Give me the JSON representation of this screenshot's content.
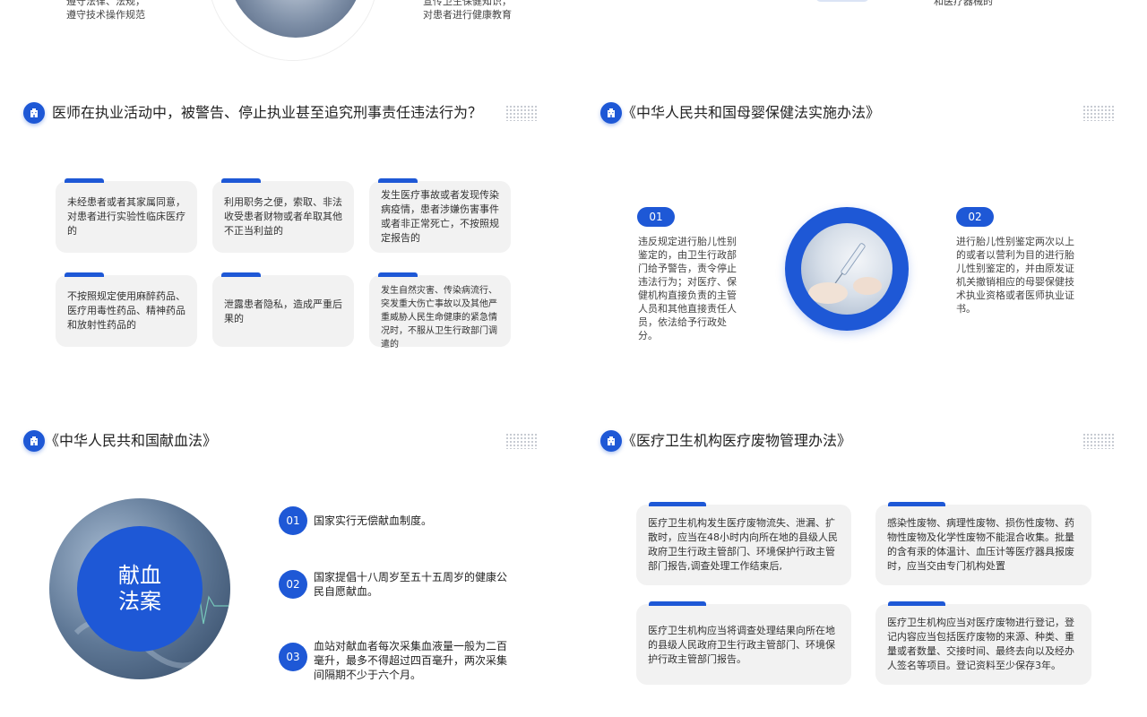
{
  "top_strip": {
    "left_text": "遵守法律、法规，\n遵守技术操作规范",
    "middle_text": "宣传卫生保健知识，\n对患者进行健康教育",
    "right_text": "和医疗器械的"
  },
  "sections": {
    "s1": {
      "title": "医师在执业活动中，被警告、停止执业甚至追究刑事责任违法行为？"
    },
    "s2": {
      "title": "《中华人民共和国母婴保健法实施办法》"
    },
    "s3": {
      "title": "《中华人民共和国献血法》"
    },
    "s4": {
      "title": "《医疗卫生机构医疗废物管理办法》"
    }
  },
  "violations": [
    "未经患者或者其家属同意，对患者进行实验性临床医疗的",
    "利用职务之便，索取、非法收受患者财物或者牟取其他不正当利益的",
    "发生医疗事故或者发现传染病疫情，患者涉嫌伤害事件或者非正常死亡，不按照规定报告的",
    "不按照规定使用麻醉药品、医疗用毒性药品、精神药品和放射性药品的",
    "泄露患者隐私，造成严重后果的",
    "发生自然灾害、传染病流行、突发重大伤亡事故以及其他严重威胁人民生命健康的紧急情况时，不服从卫生行政部门调遣的"
  ],
  "maternal": {
    "badge1": "01",
    "text1": "违反规定进行胎儿性别鉴定的，由卫生行政部门给予警告，责令停止违法行为；对医疗、保健机构直接负责的主管人员和其他直接责任人员，依法给予行政处分。",
    "badge2": "02",
    "text2": "进行胎儿性别鉴定两次以上的或者以营利为目的进行胎儿性别鉴定的，并由原发证机关撤销相应的母婴保健技术执业资格或者医师执业证书。"
  },
  "blood": {
    "circle_label": "献血\n法案",
    "items": [
      {
        "num": "01",
        "text": "国家实行无偿献血制度。"
      },
      {
        "num": "02",
        "text": "国家提倡十八周岁至五十五周岁的健康公民自愿献血。"
      },
      {
        "num": "03",
        "text": "血站对献血者每次采集血液量一般为二百毫升，最多不得超过四百毫升，两次采集间隔期不少于六个月。"
      }
    ]
  },
  "waste": [
    "医疗卫生机构发生医疗废物流失、泄漏、扩散时，应当在48小时内向所在地的县级人民政府卫生行政主管部门、环境保护行政主管部门报告,调查处理工作结束后,",
    "感染性废物、病理性废物、损伤性废物、药物性废物及化学性废物不能混合收集。批量的含有汞的体温计、血压计等医疗器具报废时，应当交由专门机构处置",
    "医疗卫生机构应当将调查处理结果向所在地的县级人民政府卫生行政主管部门、环境保护行政主管部门报告。",
    "医疗卫生机构应当对医疗废物进行登记，登记内容应当包括医疗废物的来源、种类、重量或者数量、交接时间、最终去向以及经办人签名等项目。登记资料至少保存3年。"
  ],
  "colors": {
    "accent": "#1e58d6",
    "card_bg": "#f2f2f2"
  },
  "icons": {
    "section_icon": "building-icon",
    "decoration": "dot-grid-icon"
  }
}
